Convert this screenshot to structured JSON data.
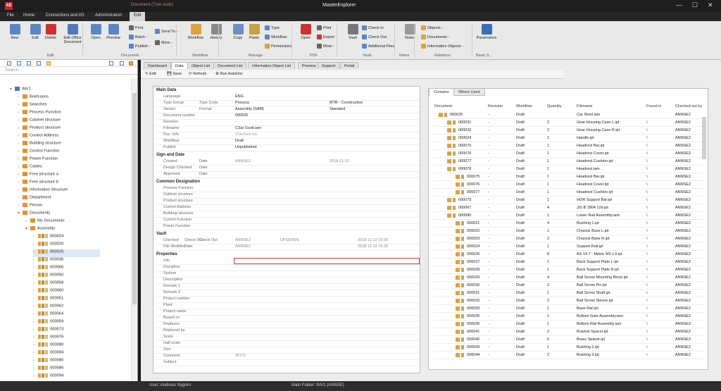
{
  "app": {
    "title": "MasterExplorer",
    "context_title": "Document (Tree node)",
    "logo": "AE"
  },
  "window": {
    "min": "—",
    "max": "☐",
    "close": "✕"
  },
  "menu": [
    "File",
    "Home",
    "Connections and I/O",
    "Administration",
    "Edit"
  ],
  "ribbon": {
    "buttons": [
      {
        "label": "New",
        "icon": "new-icon"
      },
      {
        "label": "Edit",
        "icon": "edit-icon"
      },
      {
        "label": "Delete",
        "icon": "delete-icon"
      },
      {
        "label": "Edit Office\nDocument",
        "icon": "office-edit-icon"
      },
      {
        "label": "Open",
        "icon": "open-icon"
      },
      {
        "label": "Preview",
        "icon": "preview-icon"
      },
      {
        "label": "Workflow",
        "icon": "workflow-icon"
      },
      {
        "label": "History",
        "icon": "history-icon"
      },
      {
        "label": "Copy",
        "icon": "copy-icon"
      },
      {
        "label": "Paste",
        "icon": "paste-icon"
      },
      {
        "label": "Open",
        "icon": "pdf-open-icon"
      },
      {
        "label": "Vault",
        "icon": "vault-icon"
      },
      {
        "label": "Notes",
        "icon": "notes-icon"
      },
      {
        "label": "Parameters",
        "icon": "parameters-icon"
      }
    ],
    "small": [
      "Print",
      "Batch -",
      "Publish -",
      "Send To -",
      "More -",
      "Type",
      "Workflow",
      "Permissions",
      "Print",
      "Export",
      "More -",
      "Check In",
      "Check Out",
      "Additional Files",
      "Objects -",
      "Documents -",
      "Information Objects -"
    ],
    "groups": [
      "Edit",
      "Document",
      "Workflow",
      "Manage",
      "PDF",
      "Vault",
      "Notes",
      "Relations",
      "Basic S..."
    ]
  },
  "left": {
    "search_placeholder": "Search...",
    "tree": [
      {
        "label": "INV1",
        "lvl": 0
      },
      {
        "label": "Briefcases",
        "lvl": 1
      },
      {
        "label": "Searches",
        "lvl": 1
      },
      {
        "label": "Process Function",
        "lvl": 1
      },
      {
        "label": "Cabinet structure",
        "lvl": 1
      },
      {
        "label": "Product structure",
        "lvl": 1
      },
      {
        "label": "Control Address",
        "lvl": 1
      },
      {
        "label": "Building structure",
        "lvl": 1
      },
      {
        "label": "Control Function",
        "lvl": 1
      },
      {
        "label": "Power Function",
        "lvl": 1
      },
      {
        "label": "Cables",
        "lvl": 1
      },
      {
        "label": "Free structure a",
        "lvl": 1
      },
      {
        "label": "Free structure b",
        "lvl": 1
      },
      {
        "label": "Information Structure",
        "lvl": 1
      },
      {
        "label": "Department",
        "lvl": 1
      },
      {
        "label": "Person",
        "lvl": 1
      },
      {
        "label": "Documents",
        "lvl": 1
      },
      {
        "label": "My Documents",
        "lvl": 2
      },
      {
        "label": "Assembly",
        "lvl": 2
      },
      {
        "label": "000024",
        "lvl": 3
      },
      {
        "label": "000020",
        "lvl": 3
      },
      {
        "label": "000025",
        "lvl": 3
      },
      {
        "label": "000036",
        "lvl": 3
      },
      {
        "label": "000066",
        "lvl": 3
      },
      {
        "label": "000050",
        "lvl": 3
      },
      {
        "label": "000058",
        "lvl": 3
      },
      {
        "label": "000060",
        "lvl": 3
      },
      {
        "label": "000061",
        "lvl": 3
      },
      {
        "label": "000062",
        "lvl": 3
      },
      {
        "label": "000064",
        "lvl": 3
      },
      {
        "label": "000059",
        "lvl": 3
      },
      {
        "label": "000073",
        "lvl": 3
      },
      {
        "label": "000076",
        "lvl": 3
      },
      {
        "label": "000080",
        "lvl": 3
      },
      {
        "label": "000084",
        "lvl": 3
      },
      {
        "label": "000085",
        "lvl": 3
      },
      {
        "label": "000086",
        "lvl": 3
      },
      {
        "label": "000094",
        "lvl": 3
      }
    ]
  },
  "tabs": [
    "Dashboard",
    "Data",
    "Object List",
    "Document List",
    "Information Object List",
    "Preview",
    "Support",
    "Portal"
  ],
  "toolbar": [
    "Edit",
    "Save",
    "Refresh",
    "Run AutoDoc"
  ],
  "form": {
    "sections": [
      "Main Data",
      "Sign and Date",
      "Common Designation",
      "Vault",
      "Properties"
    ],
    "main": [
      [
        "Language",
        "ENG"
      ],
      [
        "Type Group",
        "Process"
      ],
      [
        "Variant",
        "Assembly (SAM)"
      ],
      [
        "Document number",
        "000025"
      ],
      [
        "Revision",
        "-"
      ],
      [
        "Filename",
        "CSar Scott.iam"
      ],
      [
        "Doc. Info",
        "Checked out"
      ],
      [
        "Workflow",
        "Draft"
      ],
      [
        "Publish",
        "Unpublished"
      ]
    ],
    "type_code_label": "Type Code",
    "format_label": "Format",
    "type_code": "MTB - Construction",
    "format": "Standard",
    "sign": [
      [
        "Created",
        "Date",
        "ANNSE2",
        "2018-11-12"
      ],
      [
        "Design Checked",
        "Date",
        "",
        ""
      ],
      [
        "Approved",
        "Date",
        "",
        ""
      ]
    ],
    "common": [
      "Process Function",
      "Cabinet structure",
      "Product structure",
      "Control Address",
      "Building structure",
      "Control Function",
      "Power Function"
    ],
    "vault": [
      [
        "Checked",
        "Check Ou...",
        "Check Out",
        "ANNSE2",
        "UPGRADE",
        "2018-11-12 15:30"
      ],
      [
        "File Modified",
        "Date",
        "",
        "ANNSE2",
        "",
        "2018-11-12 15:30"
      ]
    ],
    "props": [
      "Info",
      "Discipline",
      "System",
      "Description",
      "Remark 1",
      "Remark 2",
      "Project number",
      "Plant",
      "Project name",
      "Based on",
      "Replaces",
      "Replaced by",
      "Scale",
      "Half scale",
      "Size",
      "Comment",
      "Subject"
    ],
    "comment_value": "INT72"
  },
  "right": {
    "tabs": [
      "Contains",
      "Where Used"
    ],
    "headers": [
      "Document",
      "Revision",
      "Workflow",
      "Quantity",
      "Filename",
      "Found in",
      "Checked out by"
    ],
    "rows": [
      [
        "000025",
        "-",
        "Draft",
        "",
        "Car Stool.iam",
        "",
        "ANNSE2",
        0
      ],
      [
        "000031",
        "-",
        "Draft",
        "2",
        "Gear Housing Case L.ipt",
        "\\",
        "ANNSE2",
        1
      ],
      [
        "000032",
        "-",
        "Draft",
        "2",
        "Gear Housing Case R.ipt",
        "\\",
        "ANNSE2",
        1
      ],
      [
        "000024",
        "-",
        "Draft",
        "1",
        "Handle.ipt",
        "\\",
        "ANNSE2",
        1
      ],
      [
        "000075",
        "-",
        "Draft",
        "1",
        "Headrest Bar.ipt",
        "\\",
        "ANNSE2",
        1
      ],
      [
        "000076",
        "-",
        "Draft",
        "1",
        "Headrest Cover.ipt",
        "\\",
        "ANNSE2",
        1
      ],
      [
        "000077",
        "-",
        "Draft",
        "1",
        "Headrest Cushion.ipt",
        "\\",
        "ANNSE2",
        1
      ],
      [
        "000078",
        "-",
        "Draft",
        "1",
        "Headrest.iam",
        "\\",
        "ANNSE2",
        1
      ],
      [
        "000075",
        "-",
        "Draft",
        "1",
        "Headrest Bar.ipt",
        "\\",
        "ANNSE2",
        2
      ],
      [
        "000076",
        "-",
        "Draft",
        "1",
        "Headrest Cover.ipt",
        "\\",
        "ANNSE2",
        2
      ],
      [
        "000077",
        "-",
        "Draft",
        "1",
        "Headrest Cushion.ipt",
        "\\",
        "ANNSE2",
        2
      ],
      [
        "000079",
        "-",
        "Draft",
        "1",
        "HOR Support Bar.ipt",
        "\\",
        "ANNSE2",
        1
      ],
      [
        "000067",
        "-",
        "Draft",
        "4",
        "JIS B 1804 12d.ipt",
        "\\",
        "ANNSE2",
        1
      ],
      [
        "000080",
        "-",
        "Draft",
        "1",
        "Lower Rail Assembly.iam",
        "\\",
        "ANNSE2",
        1
      ],
      [
        "000021",
        "-",
        "Draft",
        "4",
        "Bushing 1.ipt",
        "\\",
        "ANNSE2",
        2
      ],
      [
        "000022",
        "-",
        "Draft",
        "1",
        "Chassis Base L.ipt",
        "\\",
        "ANNSE2",
        2
      ],
      [
        "000023",
        "-",
        "Draft",
        "2",
        "Chassis Base R.ipt",
        "\\",
        "ANNSE2",
        2
      ],
      [
        "000024",
        "-",
        "Draft",
        "1",
        "Support Rail.ipt",
        "\\",
        "ANNSE2",
        2
      ],
      [
        "000026",
        "-",
        "Draft",
        "8",
        "AS 14.7 - Metric M3 x 6.ipt",
        "\\",
        "ANNSE2",
        2
      ],
      [
        "000027",
        "-",
        "Draft",
        "1",
        "Back Support Plate L.ipt",
        "\\",
        "ANNSE2",
        2
      ],
      [
        "000028",
        "-",
        "Draft",
        "1",
        "Back Support Plate R.ipt",
        "\\",
        "ANNSE2",
        2
      ],
      [
        "000029",
        "-",
        "Draft",
        "4",
        "Ball Screw Mounting Block.ipt",
        "\\",
        "ANNSE2",
        2
      ],
      [
        "000030",
        "-",
        "Draft",
        "2",
        "Ball Screw Pin.ipt",
        "\\",
        "ANNSE2",
        2
      ],
      [
        "000031",
        "-",
        "Draft",
        "1",
        "Ball Screw Shaft.ipt",
        "\\",
        "ANNSE2",
        2
      ],
      [
        "000032",
        "-",
        "Draft",
        "2",
        "Ball Screw Sleeve.ipt",
        "\\",
        "ANNSE2",
        2
      ],
      [
        "000033",
        "-",
        "Draft",
        "1",
        "Base Rail.ipt",
        "\\",
        "ANNSE2",
        2
      ],
      [
        "000035",
        "-",
        "Draft",
        "1",
        "Bottom Gate Assembly.iam",
        "\\",
        "ANNSE2",
        2
      ],
      [
        "000036",
        "-",
        "Draft",
        "1",
        "Bottom Rail Assembly.iam",
        "\\",
        "ANNSE2",
        2
      ],
      [
        "000041",
        "-",
        "Draft",
        "2",
        "Bracket Spacer.ipt",
        "\\",
        "ANNSE2",
        2
      ],
      [
        "000042",
        "-",
        "Draft",
        "6",
        "Brass Spacer.ipt",
        "\\",
        "ANNSE2",
        2
      ],
      [
        "000043",
        "-",
        "Draft",
        "1",
        "Bushing 2.ipt",
        "\\",
        "ANNSE2",
        2
      ],
      [
        "000044",
        "-",
        "Draft",
        "2",
        "Bushing 3.ipt",
        "\\",
        "ANNSE2",
        2
      ]
    ]
  },
  "status": {
    "user": "User: Andreas Nygren",
    "folder": "Main Folder: INV1 (ANNSE)"
  }
}
